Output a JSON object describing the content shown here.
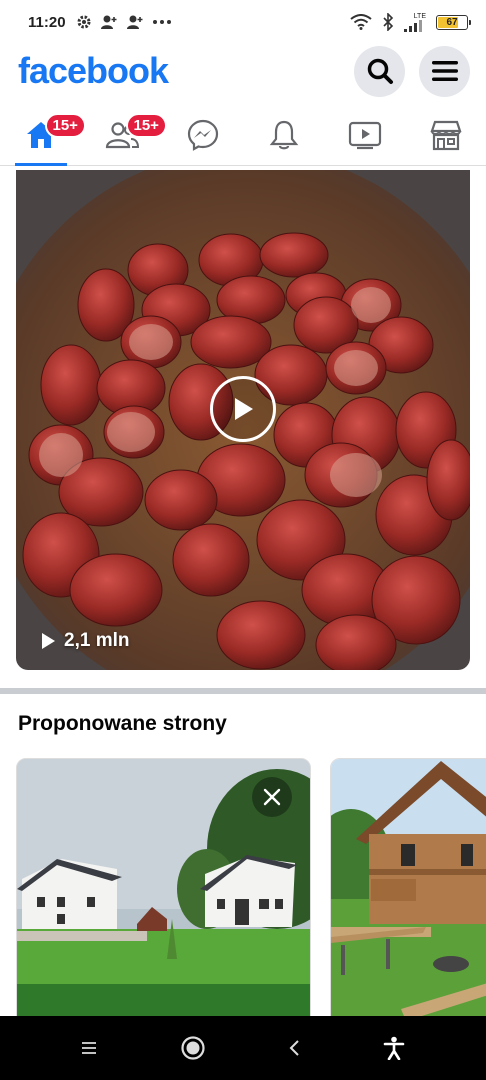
{
  "status": {
    "time": "11:20",
    "network": "LTE",
    "battery": "67",
    "battery_level": 0.67,
    "icons": [
      "gear-icon",
      "add-person-icon",
      "add-person-icon",
      "more-dots-icon",
      "wifi-icon",
      "bluetooth-icon",
      "signal-icon",
      "battery-icon"
    ]
  },
  "header": {
    "logo": "facebook",
    "search_icon": "search-icon",
    "menu_icon": "hamburger-menu-icon"
  },
  "nav": {
    "tabs": [
      {
        "name": "home",
        "icon": "home-icon",
        "badge": "15+",
        "active": true
      },
      {
        "name": "friends",
        "icon": "friends-icon",
        "badge": "15+",
        "active": false
      },
      {
        "name": "messenger",
        "icon": "messenger-icon",
        "badge": "",
        "active": false
      },
      {
        "name": "notifications",
        "icon": "bell-icon",
        "badge": "",
        "active": false
      },
      {
        "name": "watch",
        "icon": "video-icon",
        "badge": "",
        "active": false
      },
      {
        "name": "marketplace",
        "icon": "store-icon",
        "badge": "",
        "active": false
      }
    ]
  },
  "video": {
    "views": "2,1 mln"
  },
  "suggested": {
    "title": "Proponowane strony"
  },
  "colors": {
    "brand": "#1877f2",
    "badge": "#e41e3f"
  }
}
